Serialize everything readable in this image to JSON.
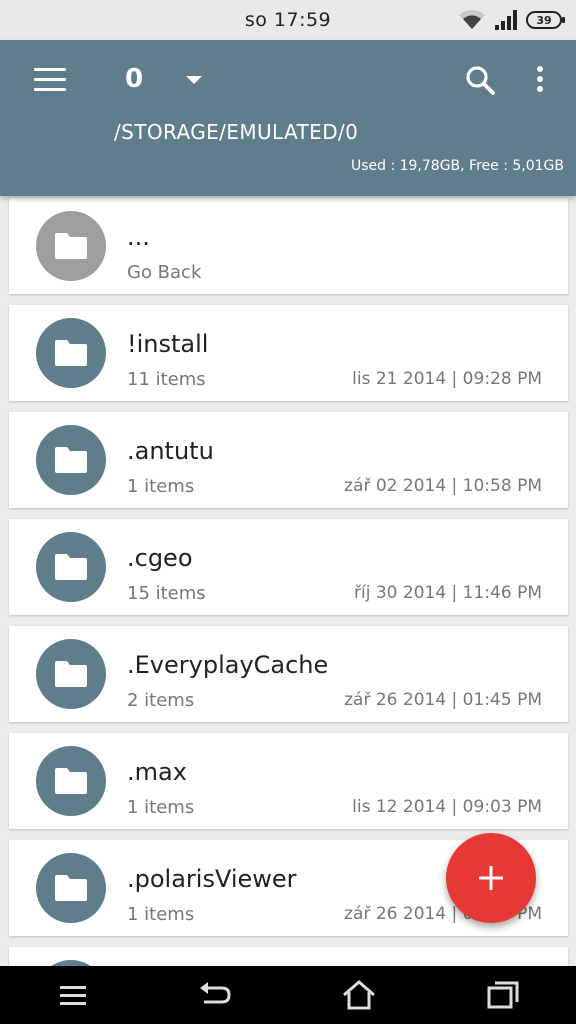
{
  "status_bar": {
    "time": "so 17:59",
    "battery": "39"
  },
  "app_bar": {
    "tab_count": "0",
    "path": "/STORAGE/EMULATED/0",
    "storage_info": "Used : 19,78GB, Free : 5,01GB"
  },
  "files": [
    {
      "name": "...",
      "sub": "Go Back",
      "date": ""
    },
    {
      "name": "!install",
      "sub": "11 items",
      "date": "lis 21 2014 | 09:28 PM"
    },
    {
      "name": ".antutu",
      "sub": "1 items",
      "date": "zář 02 2014 | 10:58 PM"
    },
    {
      "name": ".cgeo",
      "sub": "15 items",
      "date": "říj 30 2014 | 11:46 PM"
    },
    {
      "name": ".EveryplayCache",
      "sub": "2 items",
      "date": "zář 26 2014 | 01:45 PM"
    },
    {
      "name": ".max",
      "sub": "1 items",
      "date": "lis 12 2014 | 09:03 PM"
    },
    {
      "name": ".polarisViewer",
      "sub": "1 items",
      "date": "zář 26 2014 | 01:45 PM"
    }
  ],
  "colors": {
    "primary": "#607d8b",
    "accent": "#e53935",
    "back_avatar": "#9e9e9e"
  },
  "icons": [
    "menu-icon",
    "dropdown-icon",
    "search-icon",
    "more-vert-icon",
    "folder-icon",
    "add-icon",
    "wifi-icon",
    "signal-icon",
    "battery-icon",
    "nav-menu-icon",
    "nav-back-icon",
    "nav-home-icon",
    "nav-recents-icon"
  ]
}
